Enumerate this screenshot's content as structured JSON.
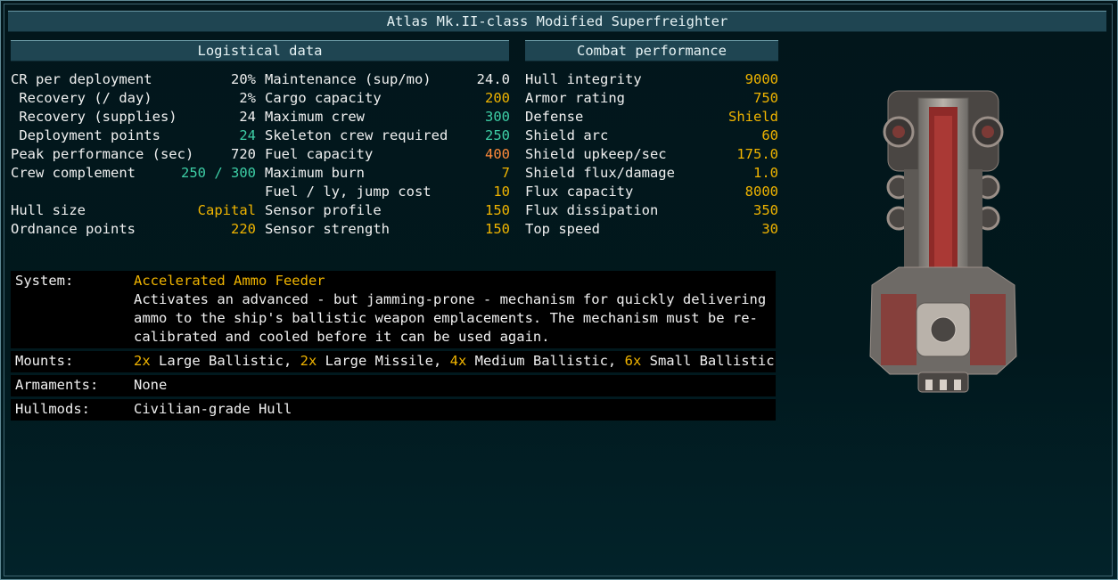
{
  "title": "Atlas Mk.II-class Modified Superfreighter",
  "sections": {
    "logistical": "Logistical data",
    "combat": "Combat performance"
  },
  "colors": {
    "accent": "#f0b400",
    "positive": "#3ecfa6",
    "warning": "#ff8a3a",
    "header_bg": "#1f4552"
  },
  "col1": [
    {
      "label": "CR per deployment",
      "value": "20%",
      "color": "white"
    },
    {
      "label": " Recovery (/ day)",
      "value": "2%",
      "color": "white"
    },
    {
      "label": " Recovery (supplies)",
      "value": "24",
      "color": "white"
    },
    {
      "label": " Deployment points",
      "value": "24",
      "color": "teal"
    },
    {
      "label": "Peak performance (sec)",
      "value": "720",
      "color": "white"
    },
    {
      "label": "Crew complement",
      "value": "250 / 300",
      "color": "teal"
    },
    {
      "label": "",
      "value": "",
      "color": "white"
    },
    {
      "label": "Hull size",
      "value": "Capital",
      "color": "yellow"
    },
    {
      "label": "Ordnance points",
      "value": "220",
      "color": "yellow"
    }
  ],
  "col2": [
    {
      "label": "Maintenance (sup/mo)",
      "value": "24.0",
      "color": "white"
    },
    {
      "label": "Cargo capacity",
      "value": "200",
      "color": "yellow"
    },
    {
      "label": "Maximum crew",
      "value": "300",
      "color": "teal"
    },
    {
      "label": "Skeleton crew required",
      "value": "250",
      "color": "teal"
    },
    {
      "label": "Fuel capacity",
      "value": "400",
      "color": "orange"
    },
    {
      "label": "Maximum burn",
      "value": "7",
      "color": "yellow"
    },
    {
      "label": "Fuel / ly, jump cost",
      "value": "10",
      "color": "yellow"
    },
    {
      "label": "Sensor profile",
      "value": "150",
      "color": "yellow"
    },
    {
      "label": "Sensor strength",
      "value": "150",
      "color": "yellow"
    }
  ],
  "col3": [
    {
      "label": "Hull integrity",
      "value": "9000",
      "color": "yellow"
    },
    {
      "label": "Armor rating",
      "value": "750",
      "color": "yellow"
    },
    {
      "label": "Defense",
      "value": "Shield",
      "color": "yellow"
    },
    {
      "label": "Shield arc",
      "value": "60",
      "color": "yellow"
    },
    {
      "label": "Shield upkeep/sec",
      "value": "175.0",
      "color": "yellow"
    },
    {
      "label": "Shield flux/damage",
      "value": "1.0",
      "color": "yellow"
    },
    {
      "label": "Flux capacity",
      "value": "8000",
      "color": "yellow"
    },
    {
      "label": "Flux dissipation",
      "value": "350",
      "color": "yellow"
    },
    {
      "label": "Top speed",
      "value": "30",
      "color": "yellow"
    }
  ],
  "system": {
    "label": "System:",
    "name": "Accelerated Ammo Feeder",
    "desc_lines": [
      "Activates an advanced - but jamming-prone - mechanism for quickly delivering",
      "ammo to the ship's ballistic weapon emplacements. The mechanism must be re-",
      "calibrated and cooled before it can be used again."
    ]
  },
  "mounts": {
    "label": "Mounts:",
    "items": [
      {
        "count": "2x",
        "name": " Large Ballistic,"
      },
      {
        "count": " 2x",
        "name": " Large Missile,"
      },
      {
        "count": " 4x",
        "name": " Medium Ballistic,"
      },
      {
        "count": " 6x",
        "name": " Small Ballistic"
      }
    ]
  },
  "armaments": {
    "label": "Armaments:",
    "value": "None"
  },
  "hullmods": {
    "label": "Hullmods:",
    "value": "Civilian-grade Hull"
  },
  "ship_image": "ship-sprite"
}
